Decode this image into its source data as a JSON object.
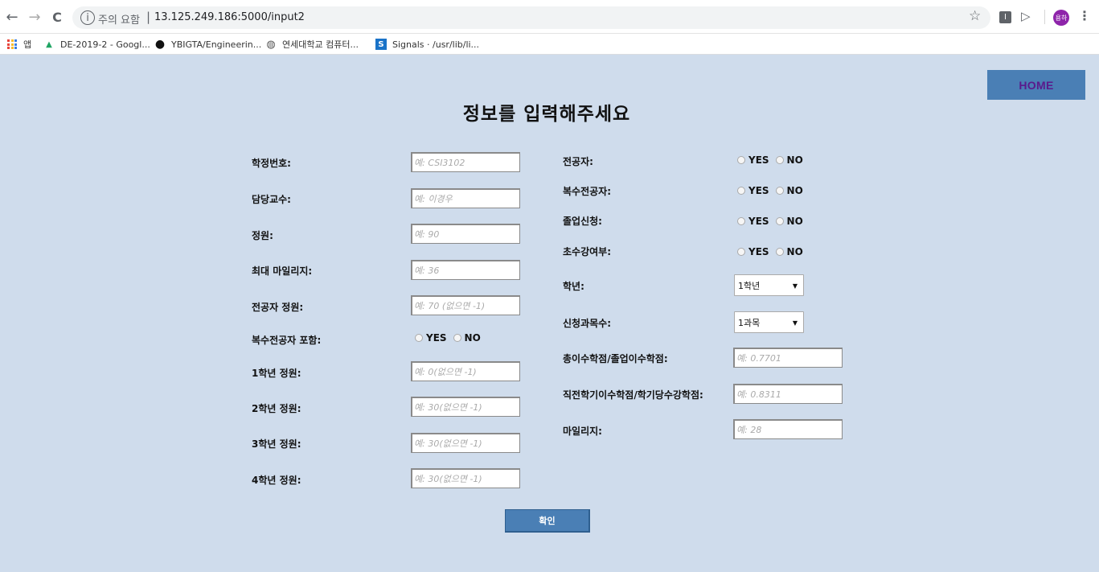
{
  "browser": {
    "back_glyph": "←",
    "forward_glyph": "→",
    "reload_glyph": "C",
    "info_glyph": "i",
    "security_warning": "주의 요함",
    "separator": "|",
    "url": "13.125.249.186:5000/input2",
    "star_glyph": "☆",
    "ext1_glyph": "I",
    "ext2_glyph": "▷",
    "profile_initials": "용하",
    "menu_glyph": "⋮",
    "bookmarks": [
      {
        "label": "앱",
        "icon": "apps-grid-icon"
      },
      {
        "label": "DE-2019-2 - Googl...",
        "icon": "google-drive-icon",
        "icon_glyph": "▲"
      },
      {
        "label": "YBIGTA/Engineerin...",
        "icon": "github-icon",
        "icon_glyph": "●"
      },
      {
        "label": "연세대학교 컴퓨터...",
        "icon": "globe-icon",
        "icon_glyph": "◍"
      },
      {
        "label": "Signals · /usr/lib/li...",
        "icon": "s-site-icon",
        "icon_glyph": "S"
      }
    ]
  },
  "page": {
    "home_label": "HOME",
    "title": "정보를 입력해주세요",
    "submit_label": "확인"
  },
  "left_form": {
    "course_id": {
      "label": "학정번호:",
      "placeholder": "예: CSI3102"
    },
    "professor": {
      "label": "담당교수:",
      "placeholder": "예: 이경우"
    },
    "capacity": {
      "label": "정원:",
      "placeholder": "예: 90"
    },
    "max_mileage": {
      "label": "최대 마일리지:",
      "placeholder": "예: 36"
    },
    "major_capacity": {
      "label": "전공자 정원:",
      "placeholder": "예: 70 (없으면 -1)"
    },
    "double_major_included": {
      "label": "복수전공자 포함:",
      "yes": "YES",
      "no": "NO"
    },
    "grade1_capacity": {
      "label": "1학년 정원:",
      "placeholder": "예: 0(없으면 -1)"
    },
    "grade2_capacity": {
      "label": "2학년 정원:",
      "placeholder": "예: 30(없으면 -1)"
    },
    "grade3_capacity": {
      "label": "3학년 정원:",
      "placeholder": "예: 30(없으면 -1)"
    },
    "grade4_capacity": {
      "label": "4학년 정원:",
      "placeholder": "예: 30(없으면 -1)"
    }
  },
  "right_form": {
    "is_major": {
      "label": "전공자:",
      "yes": "YES",
      "no": "NO"
    },
    "is_double_major": {
      "label": "복수전공자:",
      "yes": "YES",
      "no": "NO"
    },
    "graduation_applied": {
      "label": "졸업신청:",
      "yes": "YES",
      "no": "NO"
    },
    "first_time": {
      "label": "초수강여부:",
      "yes": "YES",
      "no": "NO"
    },
    "grade": {
      "label": "학년:",
      "selected": "1학년"
    },
    "num_courses": {
      "label": "신청과목수:",
      "selected": "1과목"
    },
    "credit_ratio": {
      "label": "총이수학점/졸업이수학점:",
      "placeholder": "예: 0.7701"
    },
    "semester_ratio": {
      "label": "직전학기이수학점/학기당수강학점:",
      "placeholder": "예: 0.8311"
    },
    "mileage": {
      "label": "마일리지:",
      "placeholder": "예: 28"
    }
  }
}
